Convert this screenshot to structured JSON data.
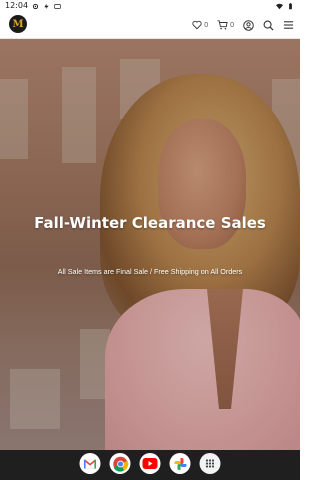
{
  "status_bar": {
    "time": "12:04",
    "icons": [
      "settings-icon",
      "notification-icon",
      "cast-icon",
      "wifi-icon",
      "battery-icon"
    ]
  },
  "header": {
    "logo_letter": "M",
    "wishlist_count": "0",
    "cart_count": "0",
    "icons": [
      "heart-icon",
      "cart-icon",
      "account-icon",
      "search-icon",
      "menu-icon"
    ]
  },
  "hero": {
    "title": "Fall-Winter Clearance Sales",
    "subtitle": "All Sale Items are Final Sale / Free Shipping on All Orders"
  },
  "dock": {
    "apps": [
      "gmail-icon",
      "chrome-icon",
      "youtube-icon",
      "photos-icon",
      "app-drawer-icon"
    ]
  },
  "colors": {
    "brand_gold": "#d8a628",
    "nav_bar": "#1f1f1f"
  }
}
